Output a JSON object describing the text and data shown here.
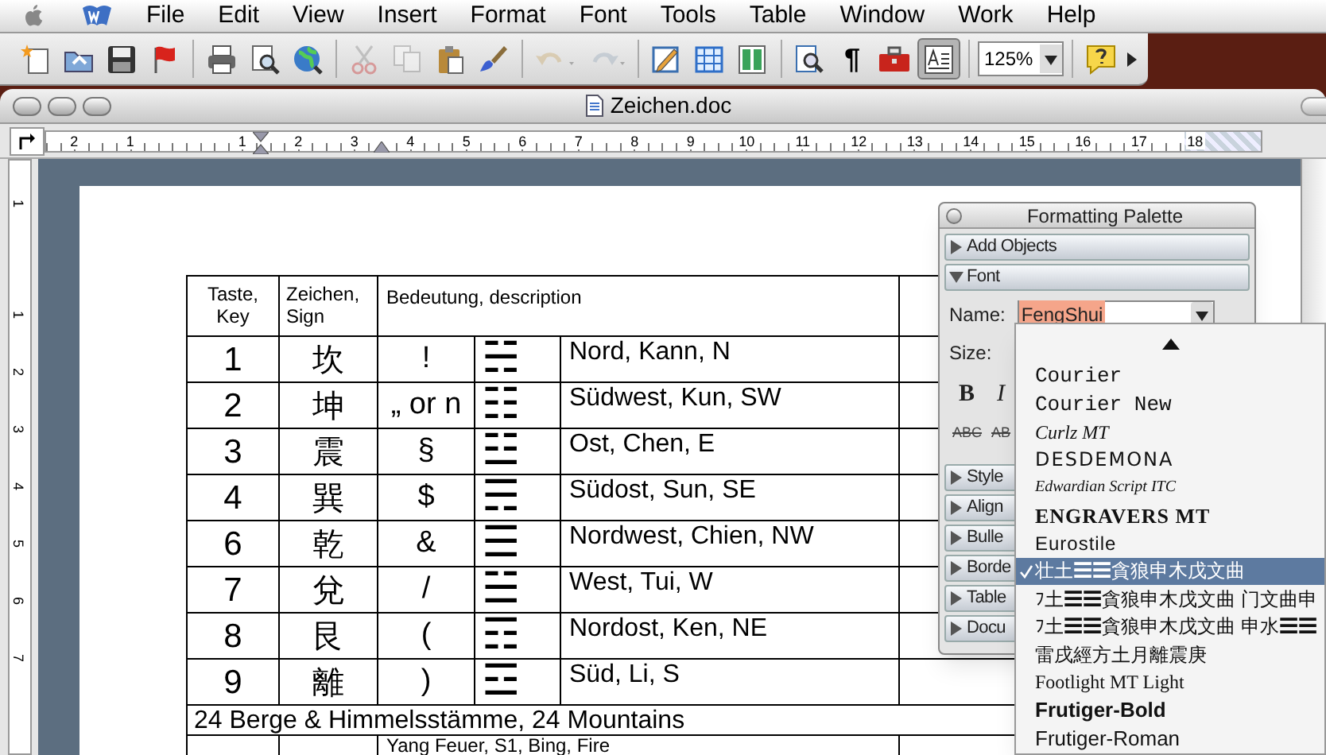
{
  "menu_bar": {
    "items": [
      "File",
      "Edit",
      "View",
      "Insert",
      "Format",
      "Font",
      "Tools",
      "Table",
      "Window",
      "Work",
      "Help"
    ]
  },
  "toolbar": {
    "buttons": [
      {
        "disabled": false,
        "pressed": false
      },
      {
        "disabled": false,
        "pressed": false
      },
      {
        "disabled": false,
        "pressed": false
      },
      {
        "disabled": false,
        "pressed": false
      },
      {
        "disabled": false,
        "pressed": false
      },
      {
        "disabled": false,
        "pressed": false
      },
      {
        "disabled": false,
        "pressed": false
      },
      {
        "disabled": true,
        "pressed": false
      },
      {
        "disabled": true,
        "pressed": false
      },
      {
        "disabled": false,
        "pressed": false
      },
      {
        "disabled": false,
        "pressed": false
      },
      {
        "disabled": true,
        "pressed": false
      },
      {
        "disabled": true,
        "pressed": false
      },
      {
        "disabled": false,
        "pressed": false
      },
      {
        "disabled": false,
        "pressed": false
      },
      {
        "disabled": false,
        "pressed": false
      },
      {
        "disabled": false,
        "pressed": false
      },
      {
        "label": "¶",
        "disabled": false,
        "pressed": false
      },
      {
        "disabled": false,
        "pressed": false
      },
      {
        "disabled": false,
        "pressed": true
      },
      {
        "disabled": false,
        "pressed": false
      },
      {
        "disabled": false,
        "pressed": false
      }
    ],
    "zoom": "125%"
  },
  "window": {
    "title": "Zeichen.doc"
  },
  "ruler": {
    "labels": [
      "2",
      "1",
      "1",
      "2",
      "3",
      "4",
      "5",
      "6",
      "7",
      "8",
      "9",
      "10",
      "11",
      "12",
      "13",
      "14",
      "15",
      "16",
      "17",
      "18"
    ]
  },
  "vertical_ruler": {
    "labels": [
      "1",
      "1",
      "2",
      "3",
      "4",
      "5",
      "6",
      "7"
    ]
  },
  "table": {
    "header": {
      "key": "Taste, Key",
      "sign": "Zeichen, Sign",
      "meaning": "Bedeutung, description"
    },
    "rows": [
      {
        "key": "1",
        "sign": "坎",
        "symbol": "!",
        "trigram": "☵",
        "description": "Nord, Kann, N"
      },
      {
        "key": "2",
        "sign": "坤",
        "symbol": "„ or n",
        "trigram": "☷",
        "description": "Südwest, Kun, SW"
      },
      {
        "key": "3",
        "sign": "震",
        "symbol": "§",
        "trigram": "☳",
        "description": "Ost, Chen, E"
      },
      {
        "key": "4",
        "sign": "巽",
        "symbol": "$",
        "trigram": "☴",
        "description": "Südost, Sun, SE"
      },
      {
        "key": "6",
        "sign": "乾",
        "symbol": "&",
        "trigram": "☰",
        "description": "Nordwest, Chien, NW"
      },
      {
        "key": "7",
        "sign": "兌",
        "symbol": "/",
        "trigram": "☱",
        "description": "West, Tui, W"
      },
      {
        "key": "8",
        "sign": "艮",
        "symbol": "(",
        "trigram": "☶",
        "description": "Nordost, Ken, NE"
      },
      {
        "key": "9",
        "sign": "離",
        "symbol": ")",
        "trigram": "☲",
        "description": "Süd, Li, S"
      }
    ],
    "section": "24 Berge & Himmelsstämme, 24 Mountains",
    "partial_row": {
      "description": "Yang Feuer, S1, Bing, Fire"
    }
  },
  "palette": {
    "title": "Formatting Palette",
    "sections": [
      {
        "label": "Add Objects",
        "expanded": false
      },
      {
        "label": "Font",
        "expanded": true
      },
      {
        "label": "Style",
        "expanded": false
      },
      {
        "label": "Align",
        "expanded": false
      },
      {
        "label": "Bulle",
        "expanded": false
      },
      {
        "label": "Borde",
        "expanded": false
      },
      {
        "label": "Table",
        "expanded": false
      },
      {
        "label": "Docu",
        "expanded": false
      }
    ],
    "font": {
      "name_label": "Name:",
      "name_value": "FengShui",
      "size_label": "Size:",
      "bold": "B",
      "italic": "I",
      "strikethrough": "ABC",
      "double_strikethrough": "AB"
    }
  },
  "font_menu": {
    "items": [
      {
        "label": "Courier",
        "selected": false
      },
      {
        "label": "Courier New",
        "selected": false
      },
      {
        "label": "Curlz MT",
        "selected": false
      },
      {
        "label": "DESDEMONA",
        "selected": false
      },
      {
        "label": "Edwardian Script ITC",
        "selected": false
      },
      {
        "label": "ENGRAVERS MT",
        "selected": false
      },
      {
        "label": "Eurostile",
        "selected": false
      },
      {
        "label": "壮土☰☰貪狼申木戊文曲",
        "selected": true
      },
      {
        "label": "ﾌ土☰☰貪狼申木戊文曲 门文曲申",
        "selected": false
      },
      {
        "label": "ﾌ土☰☰貪狼申木戊文曲 申水☰☰",
        "selected": false
      },
      {
        "label": "雷戌經方土月離震庚",
        "selected": false
      },
      {
        "label": "Footlight MT Light",
        "selected": false
      },
      {
        "label": "Frutiger-Bold",
        "selected": false
      },
      {
        "label": "Frutiger-Roman",
        "selected": false
      }
    ]
  }
}
